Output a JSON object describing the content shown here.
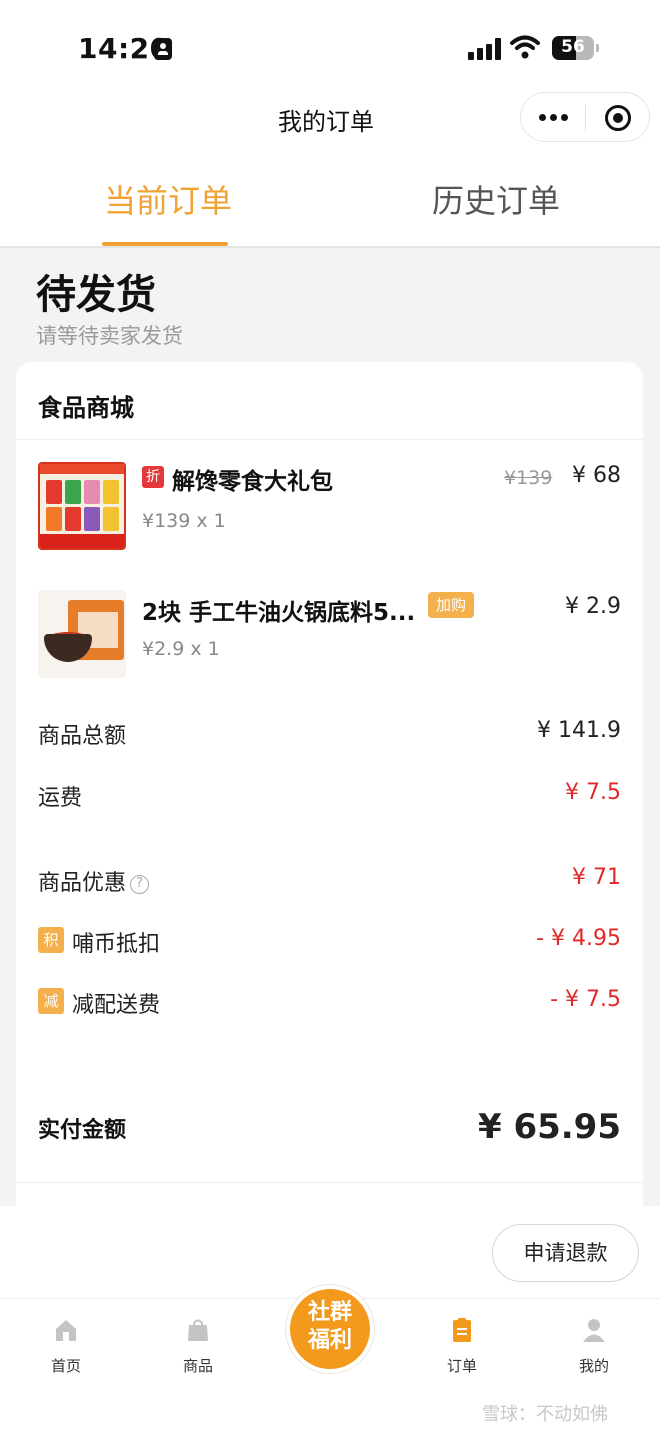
{
  "status_bar": {
    "time": "14:20",
    "battery": "56"
  },
  "nav": {
    "title": "我的订单"
  },
  "tabs": [
    {
      "label": "当前订单"
    },
    {
      "label": "历史订单"
    }
  ],
  "order_status": {
    "title": "待发货",
    "subtitle": "请等待卖家发货"
  },
  "shop": {
    "name": "食品商城"
  },
  "items": [
    {
      "tag": "折",
      "name": "解馋零食大礼包",
      "original_price": "¥139",
      "price": "¥ 68",
      "unit": "¥139 x 1"
    },
    {
      "tag": "加购",
      "name": "2块 手工牛油火锅底料5...",
      "price": "¥ 2.9",
      "unit": "¥2.9 x 1"
    }
  ],
  "summary": {
    "subtotal_label": "商品总额",
    "subtotal_value": "¥ 141.9",
    "shipping_label": "运费",
    "shipping_value": "¥ 7.5",
    "discount_label": "商品优惠",
    "discount_value": "¥ 71",
    "coin_badge": "积",
    "coin_label": "哺币抵扣",
    "coin_value": "- ¥ 4.95",
    "freeship_badge": "减",
    "freeship_label": "减配送费",
    "freeship_value": "- ¥ 7.5",
    "paid_label": "实付金额",
    "paid_value": "¥ 65.95"
  },
  "actions": {
    "refund": "申请退款"
  },
  "tab_bar": {
    "home": "首页",
    "goods": "商品",
    "center": "社群福利",
    "orders": "订单",
    "mine": "我的"
  },
  "watermark": "雪球：不动如佛",
  "colors": {
    "accent": "#f0a233",
    "red": "#e0292a",
    "badge": "#f3b04c"
  }
}
